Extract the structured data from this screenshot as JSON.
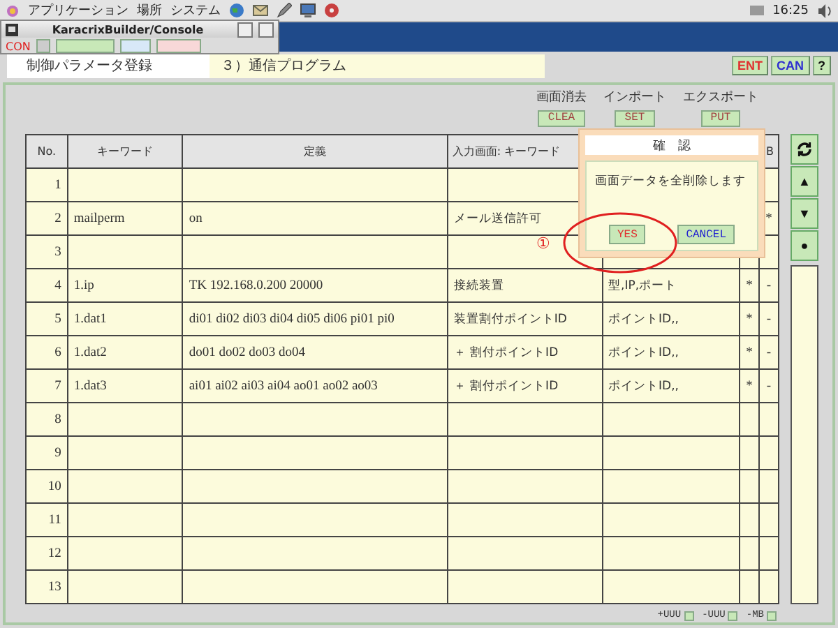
{
  "top_panel": {
    "menus": [
      "アプリケーション",
      "場所",
      "システム"
    ],
    "clock": "16:25"
  },
  "console_window": {
    "title": "KaracrixBuilder/Console",
    "toolbar_label": "CON"
  },
  "header": {
    "title": "制御パラメータ登録",
    "subtitle": "３）通信プログラム",
    "buttons": [
      {
        "label": "ENT",
        "kind": "enter"
      },
      {
        "label": "CAN",
        "kind": "cancel"
      },
      {
        "label": "?",
        "kind": "help"
      }
    ]
  },
  "actions": [
    {
      "caption": "画面消去",
      "label": "CLEA"
    },
    {
      "caption": "インポート",
      "label": "SET"
    },
    {
      "caption": "エクスポート",
      "label": "PUT"
    }
  ],
  "table": {
    "columns": [
      "No.",
      "キーワード",
      "定義",
      "入力画面: キーワード",
      "",
      "",
      "B"
    ],
    "rows": [
      {
        "no": "1",
        "keyword": "",
        "definition": "",
        "input_label": "",
        "format": "",
        "col6": "",
        "col7": ""
      },
      {
        "no": "2",
        "keyword": "mailperm",
        "definition": "on",
        "input_label": "メール送信許可",
        "format": "",
        "col6": "",
        "col7": "*"
      },
      {
        "no": "3",
        "keyword": "",
        "definition": "",
        "input_label": "",
        "format": "",
        "col6": "",
        "col7": ""
      },
      {
        "no": "4",
        "keyword": "1.ip",
        "definition": "TK 192.168.0.200 20000",
        "input_label": "接続装置",
        "format": "型,IP,ポート",
        "col6": "*",
        "col7": "-"
      },
      {
        "no": "5",
        "keyword": "1.dat1",
        "definition": "di01 di02 di03 di04 di05 di06 pi01 pi0",
        "input_label": "装置割付ポイントID",
        "format": "ポイントID,,",
        "col6": "*",
        "col7": "-"
      },
      {
        "no": "6",
        "keyword": "1.dat2",
        "definition": "do01 do02 do03 do04",
        "input_label": "＋ 割付ポイントID",
        "format": "ポイントID,,",
        "col6": "*",
        "col7": "-"
      },
      {
        "no": "7",
        "keyword": "1.dat3",
        "definition": "ai01 ai02 ai03 ai04 ao01 ao02 ao03",
        "input_label": "＋ 割付ポイントID",
        "format": "ポイントID,,",
        "col6": "*",
        "col7": "-"
      },
      {
        "no": "8",
        "keyword": "",
        "definition": "",
        "input_label": "",
        "format": "",
        "col6": "",
        "col7": ""
      },
      {
        "no": "9",
        "keyword": "",
        "definition": "",
        "input_label": "",
        "format": "",
        "col6": "",
        "col7": ""
      },
      {
        "no": "10",
        "keyword": "",
        "definition": "",
        "input_label": "",
        "format": "",
        "col6": "",
        "col7": ""
      },
      {
        "no": "11",
        "keyword": "",
        "definition": "",
        "input_label": "",
        "format": "",
        "col6": "",
        "col7": ""
      },
      {
        "no": "12",
        "keyword": "",
        "definition": "",
        "input_label": "",
        "format": "",
        "col6": "",
        "col7": ""
      },
      {
        "no": "13",
        "keyword": "",
        "definition": "",
        "input_label": "",
        "format": "",
        "col6": "",
        "col7": ""
      }
    ]
  },
  "side_buttons": [
    {
      "kind": "refresh"
    },
    {
      "kind": "up",
      "label": "▲"
    },
    {
      "kind": "down",
      "label": "▼"
    },
    {
      "kind": "dot",
      "label": "●"
    }
  ],
  "footer": [
    "+UUU",
    "-UUU",
    "-MB"
  ],
  "dialog": {
    "title": "確　認",
    "message": "画面データを全削除します",
    "buttons": [
      {
        "label": "YES",
        "kind": "yes"
      },
      {
        "label": "CANCEL",
        "kind": "cancel"
      }
    ]
  },
  "annotation": {
    "marker": "①"
  }
}
